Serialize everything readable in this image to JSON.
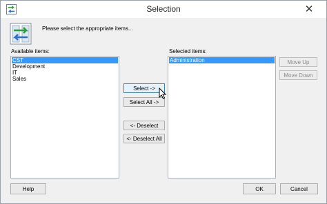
{
  "window": {
    "title": "Selection",
    "close_glyph": "✕"
  },
  "header": {
    "prompt": "Please select the appropriate items..."
  },
  "available": {
    "label": "Available items:",
    "items": [
      {
        "label": "CST",
        "selected": true
      },
      {
        "label": "Development",
        "selected": false
      },
      {
        "label": "IT",
        "selected": false
      },
      {
        "label": "Sales",
        "selected": false
      }
    ]
  },
  "selected": {
    "label": "Selected items:",
    "items": [
      {
        "label": "Administration",
        "selected": true
      }
    ]
  },
  "buttons": {
    "select": "Select ->",
    "select_all": "Select All ->",
    "deselect": "<- Deselect",
    "deselect_all": "<- Deselect All",
    "move_up": "Move Up",
    "move_down": "Move Down",
    "help": "Help",
    "ok": "OK",
    "cancel": "Cancel"
  },
  "icons": {
    "app": "transfer-arrows-icon",
    "header": "transfer-arrows-icon",
    "close": "close-icon",
    "cursor": "mouse-pointer-icon"
  },
  "colors": {
    "selection": "#3399ff",
    "accent_green": "#2e9e3a",
    "accent_blue": "#2f6fc4"
  }
}
